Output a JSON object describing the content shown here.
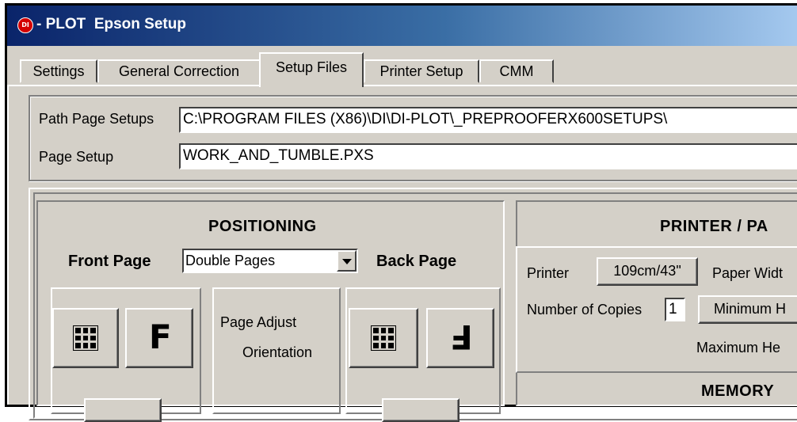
{
  "window": {
    "title": "- PLOT  Epson Setup",
    "icon_label": "DI"
  },
  "tabs": [
    {
      "label": "Settings"
    },
    {
      "label": "General Correction"
    },
    {
      "label": "Setup Files"
    },
    {
      "label": "Printer Setup"
    },
    {
      "label": "CMM"
    }
  ],
  "active_tab": "Setup Files",
  "paths": {
    "path_page_setups_label": "Path Page Setups",
    "path_page_setups_value": "C:\\PROGRAM FILES (X86)\\DI\\DI-PLOT\\_PREPROOFERX600SETUPS\\",
    "page_setup_label": "Page Setup",
    "page_setup_value": "WORK_AND_TUMBLE.PXS"
  },
  "positioning": {
    "header": "POSITIONING",
    "front_page_label": "Front Page",
    "front_page_select": "Double Pages",
    "back_page_label": "Back Page",
    "page_adjust_line1": "Page Adjust",
    "page_adjust_line2": "Orientation",
    "front_letter": "F",
    "back_letter": "F"
  },
  "printer": {
    "header": "PRINTER / PA",
    "printer_label": "Printer",
    "printer_button": "109cm/43\"",
    "paper_width_label": "Paper Widt",
    "copies_label": "Number of Copies",
    "copies_value": "1",
    "minimum_button": "Minimum H",
    "maximum_label": "Maximum He",
    "memory_header": "MEMORY"
  }
}
